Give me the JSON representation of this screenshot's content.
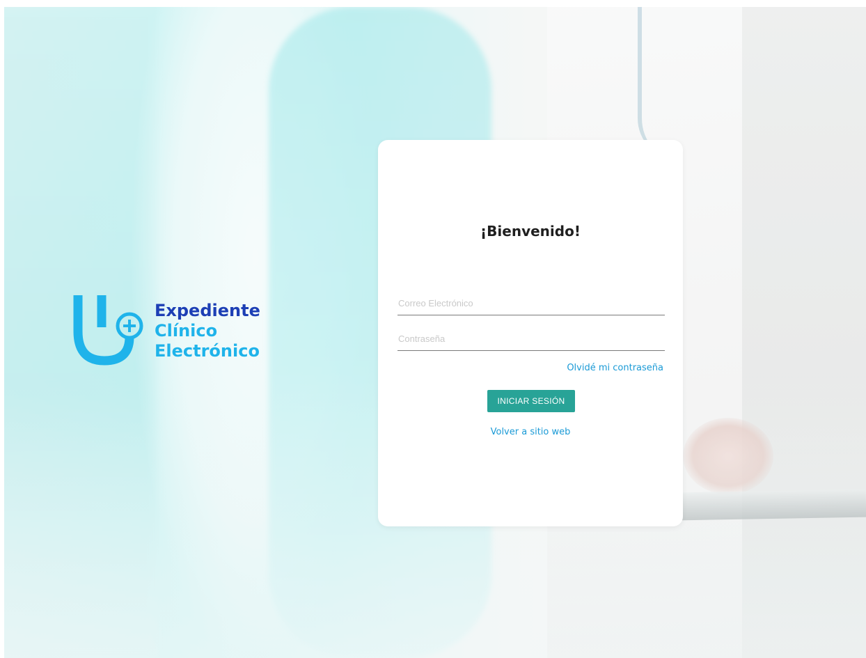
{
  "logo": {
    "line1": "Expediente",
    "line2": "Clínico",
    "line3": "Electrónico",
    "icon": "stethoscope-plus-icon",
    "colors": {
      "primary": "#1d3fb5",
      "accent": "#1fb3ea"
    }
  },
  "login": {
    "title": "¡Bienvenido!",
    "email_placeholder": "Correo Electrónico",
    "password_placeholder": "Contraseña",
    "forgot_label": "Olvidé mi contraseña",
    "submit_label": "INICIAR SESIÓN",
    "back_label": "Volver a sitio web"
  },
  "colors": {
    "button": "#28a397",
    "link": "#1a9ad6"
  }
}
